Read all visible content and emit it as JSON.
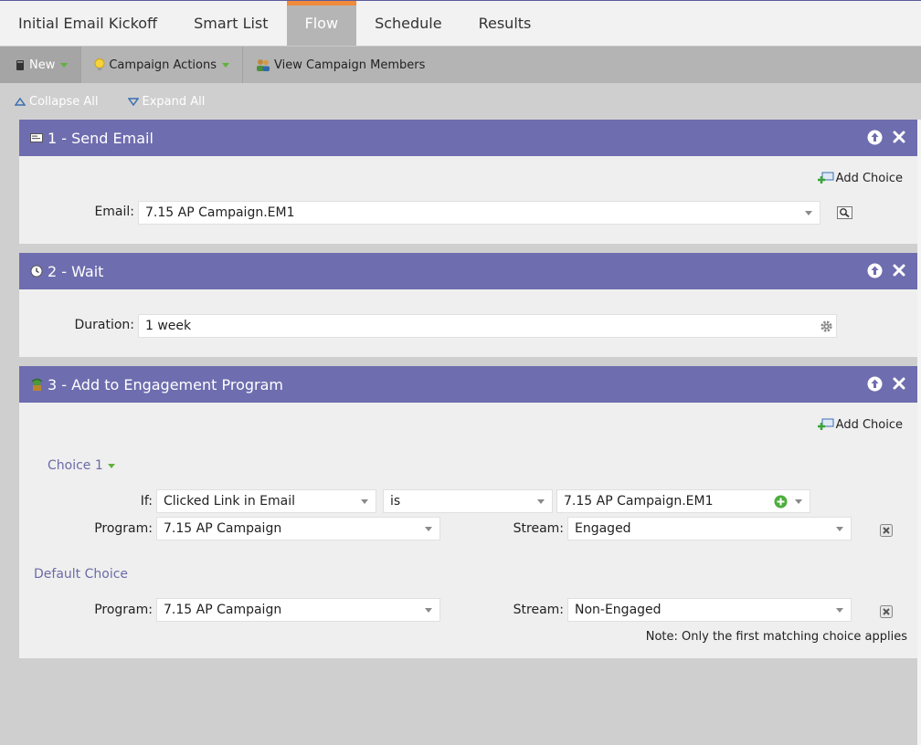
{
  "tabs": [
    {
      "label": "Initial Email Kickoff",
      "active": false
    },
    {
      "label": "Smart List",
      "active": false
    },
    {
      "label": "Flow",
      "active": true
    },
    {
      "label": "Schedule",
      "active": false
    },
    {
      "label": "Results",
      "active": false
    }
  ],
  "toolbar": {
    "new_label": "New",
    "campaign_actions_label": "Campaign Actions",
    "view_members_label": "View Campaign Members"
  },
  "collapse_all_label": "Collapse All",
  "expand_all_label": "Expand All",
  "steps": [
    {
      "title": "1 - Send Email",
      "add_choice_label": "Add Choice",
      "email_label": "Email:",
      "email_value": "7.15 AP Campaign.EM1"
    },
    {
      "title": "2 - Wait",
      "duration_label": "Duration:",
      "duration_value": "1 week"
    },
    {
      "title": "3 - Add to Engagement Program",
      "add_choice_label": "Add Choice",
      "choice1": {
        "title": "Choice 1",
        "if_label": "If:",
        "condition": "Clicked Link in Email",
        "operator": "is",
        "value": "7.15 AP Campaign.EM1",
        "program_label": "Program:",
        "program_value": "7.15 AP Campaign",
        "stream_label": "Stream:",
        "stream_value": "Engaged"
      },
      "default_choice": {
        "title": "Default Choice",
        "program_label": "Program:",
        "program_value": "7.15 AP Campaign",
        "stream_label": "Stream:",
        "stream_value": "Non-Engaged"
      },
      "note": "Note: Only the first matching choice applies"
    }
  ],
  "colors": {
    "panel_header": "#6e6daf",
    "active_tab": "#b5b5b5",
    "active_tab_accent": "#f08a3c",
    "toolbar": "#b4b4b4",
    "workspace": "#cfcfcf",
    "choice_text": "#6b6ba8",
    "dropdown_triangle_green": "#5fb23b"
  },
  "icons": {
    "new": "notebook-icon",
    "campaign_actions": "lightbulb-icon",
    "view_members": "people-icon",
    "collapse_all": "triangle-up-icon",
    "expand_all": "triangle-down-icon",
    "step1": "email-icon",
    "step2": "clock-icon",
    "step3": "engagement-icon",
    "move_up": "arrow-up-circle-icon",
    "delete": "close-icon",
    "add_choice": "add-choice-icon",
    "preview": "magnifier-preview-icon",
    "settings": "gear-icon",
    "add_value": "plus-circle-icon",
    "remove_row": "remove-row-icon"
  }
}
